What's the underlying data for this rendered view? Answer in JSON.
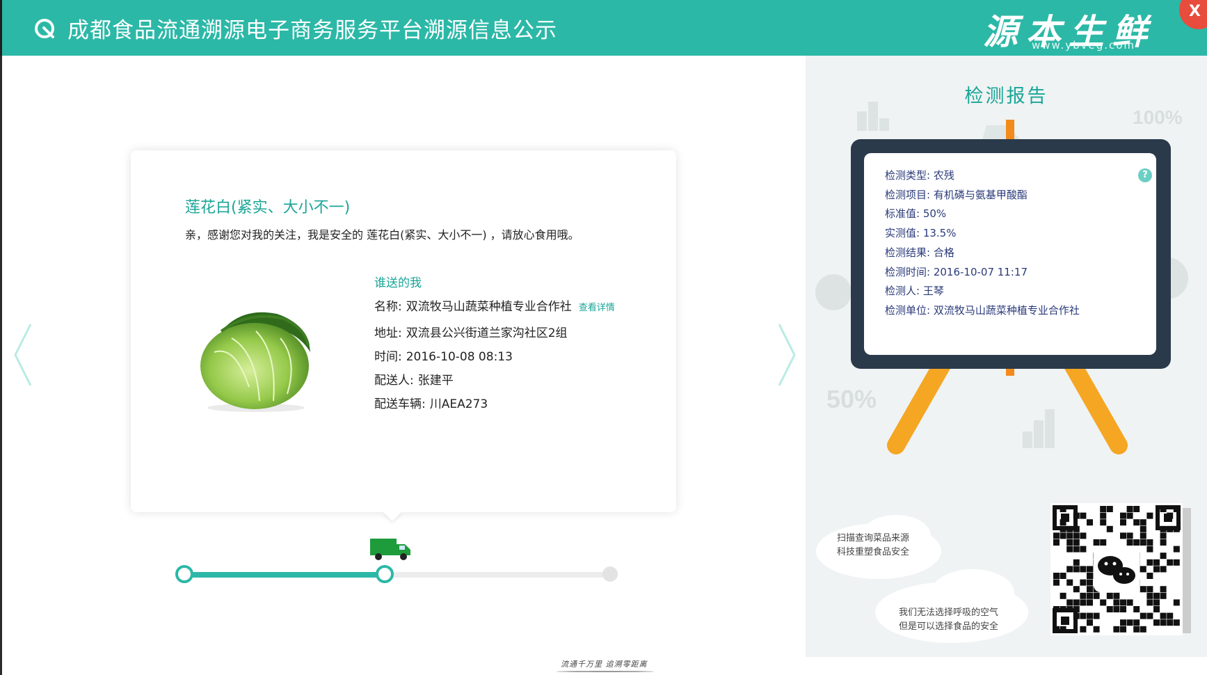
{
  "header": {
    "title": "成都食品流通溯源电子商务服务平台溯源信息公示",
    "brand": "源本生鲜",
    "brand_url": "www.ybveg.com",
    "close_label": "X"
  },
  "product": {
    "name": "莲花白(紧实、大小不一)",
    "greeting": "亲，感谢您对我的关注，我是安全的  莲花白(紧实、大小不一) ，请放心食用哦。"
  },
  "delivery": {
    "section_title": "谁送的我",
    "name_label": "名称:",
    "name_value": "双流牧马山蔬菜种植专业合作社",
    "detail_link": "查看详情",
    "address_label": "地址:",
    "address_value": "双流县公兴街道兰家沟社区2组",
    "time_label": "时间:",
    "time_value": "2016-10-08 08:13",
    "courier_label": "配送人:",
    "courier_value": "张建平",
    "vehicle_label": "配送车辆:",
    "vehicle_value": "川AEA273"
  },
  "progress": {
    "fraction": 0.47,
    "accent": "#2cb8a7"
  },
  "footer": {
    "slogan": "流通千万里 追溯零距离"
  },
  "report": {
    "title": "检测报告",
    "rows": [
      "检测类型: 农残",
      "检测项目: 有机磷与氨基甲酸酯",
      "标准值: 50%",
      "实测值: 13.5%",
      "检测结果: 合格",
      "检测时间: 2016-10-07 11:17",
      "检测人: 王琴",
      "检测单位: 双流牧马山蔬菜种植专业合作社"
    ],
    "deco_100": "100%",
    "deco_50": "50%",
    "help": "?"
  },
  "clouds": {
    "scan_line1": "扫描查询菜品来源",
    "scan_line2": "科技重塑食品安全",
    "safety_line1": "我们无法选择呼吸的空气",
    "safety_line2": "但是可以选择食品的安全"
  },
  "colors": {
    "brand_teal": "#2cb8a7",
    "text_teal": "#1aa597",
    "board_dark": "#2b3a4a",
    "easel_orange": "#f5a623",
    "close_red": "#e74c3c"
  }
}
